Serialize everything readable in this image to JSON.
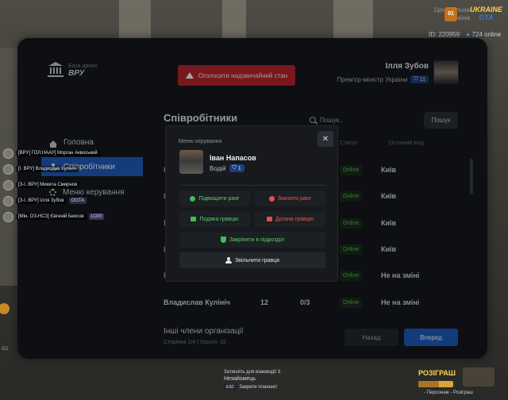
{
  "hud": {
    "region_label": "Центральна",
    "region_label2": "Україна",
    "region_badge": "01",
    "logo_line1": "UKRAINE",
    "logo_line2": "GTA",
    "player_id": "ID: 220959",
    "online": "724 online"
  },
  "brand": {
    "subtitle": "База даних",
    "title": "ВРУ"
  },
  "emergency_button": "Оголосити надзвичайний стан",
  "user": {
    "name": "Ілля Зубов",
    "role": "Прем'єр-міністр України",
    "level": "11"
  },
  "nav": {
    "home": "Головна",
    "staff": "Співробітники",
    "management": "Меню керування"
  },
  "section": {
    "title": "Співробітники",
    "search_placeholder": "Пошук..",
    "search_button": "Пошук"
  },
  "table": {
    "headers": {
      "status": "Статус",
      "last_seen": "Останній вхід"
    },
    "rows": [
      {
        "name": "Н",
        "status": "Online",
        "city": "Київ"
      },
      {
        "name": "В",
        "status": "Online",
        "city": "Київ"
      },
      {
        "name": "І",
        "status": "Online",
        "city": "Київ"
      },
      {
        "name": "L",
        "status": "Online",
        "city": "Київ"
      },
      {
        "name": "Р",
        "status": "Online",
        "city": "Не на зміні"
      },
      {
        "name": "Владислав Кулініч",
        "value1": "12",
        "value2": "0/3",
        "status": "Online",
        "city": "Не на зміні"
      }
    ]
  },
  "footer": {
    "other_members": "Інші члени організації",
    "pagination": "Сторінка 1/4 | Усього: 32",
    "back": "Назад",
    "next": "Вперед"
  },
  "modal": {
    "title": "Меню керування",
    "close": "✕",
    "player_name": "Іван Напасов",
    "player_role": "Водій",
    "player_level": "1",
    "actions": {
      "promote": "Підвищити ранг",
      "demote": "Знизити ранг",
      "thanks": "Подяка гравцю",
      "reprimand": "Догана гравцю",
      "assign": "Закріпити в підрозділ",
      "fire": "Звільнити гравця"
    }
  },
  "side_players": [
    {
      "tag": "[ВРУ] ГОЛ.НААУ] Морган Аквоський",
      "extra": ""
    },
    {
      "tag": "[І. ВРУ] Владислав Кулініч",
      "extra": ""
    },
    {
      "tag": "[З-І. ВРУ] Микита Смирнов",
      "extra": ""
    },
    {
      "tag": "[З-І. ВРУ] Ілля Зубов",
      "extra": "OGTA"
    },
    {
      "tag": "[Мін. ОЗ-НСЗ] Євгеній Бексов",
      "extra": "LOXI"
    }
  ],
  "bottom": {
    "hint1": "Затисніть для взаємодії 3",
    "hint2": "Незайомець",
    "esc_key": "ESC",
    "esc_label": "Закрити планшет",
    "prize": "РОЗІГРАШ",
    "persona": "- Персонаж - Розіграш",
    "money_progress": 0.6
  },
  "left_icons": {
    "g2": "G2"
  }
}
